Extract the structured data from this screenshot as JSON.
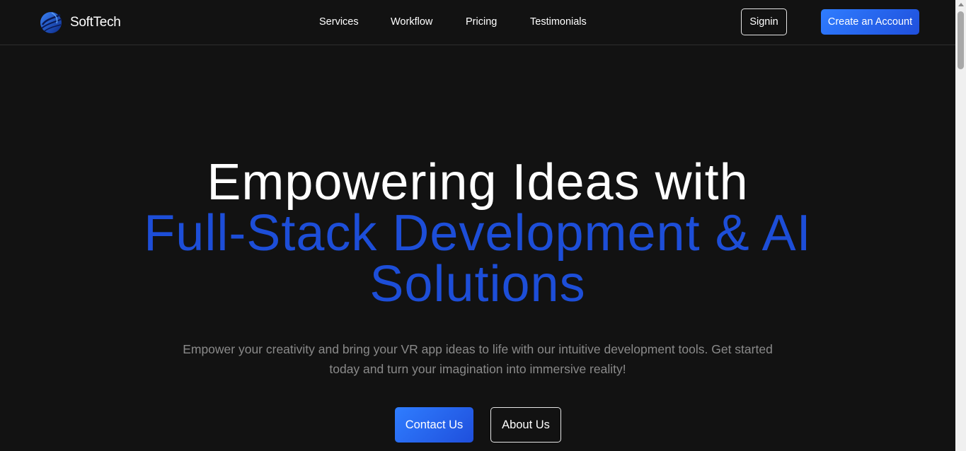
{
  "header": {
    "logo": {
      "icon": "globe-swirl-logo-icon",
      "text": "SoftTech"
    },
    "nav": [
      {
        "label": "Services"
      },
      {
        "label": "Workflow"
      },
      {
        "label": "Pricing"
      },
      {
        "label": "Testimonials"
      }
    ],
    "signin_label": "Signin",
    "create_account_label": "Create an Account"
  },
  "hero": {
    "title_line1": "Empowering Ideas with",
    "title_line2": "Full-Stack Development & AI",
    "title_line3": "Solutions",
    "subtitle_line1": "Empower your creativity and bring your VR app ideas to life with our intuitive development tools. Get started",
    "subtitle_line2": "today and turn your imagination into immersive reality!",
    "contact_label": "Contact Us",
    "about_label": "About Us"
  },
  "colors": {
    "background": "#121212",
    "accent_blue": "#1d4ed8",
    "button_gradient_start": "#2f7dff",
    "button_gradient_end": "#1f4fdc",
    "muted_text": "#8a8a8a"
  }
}
